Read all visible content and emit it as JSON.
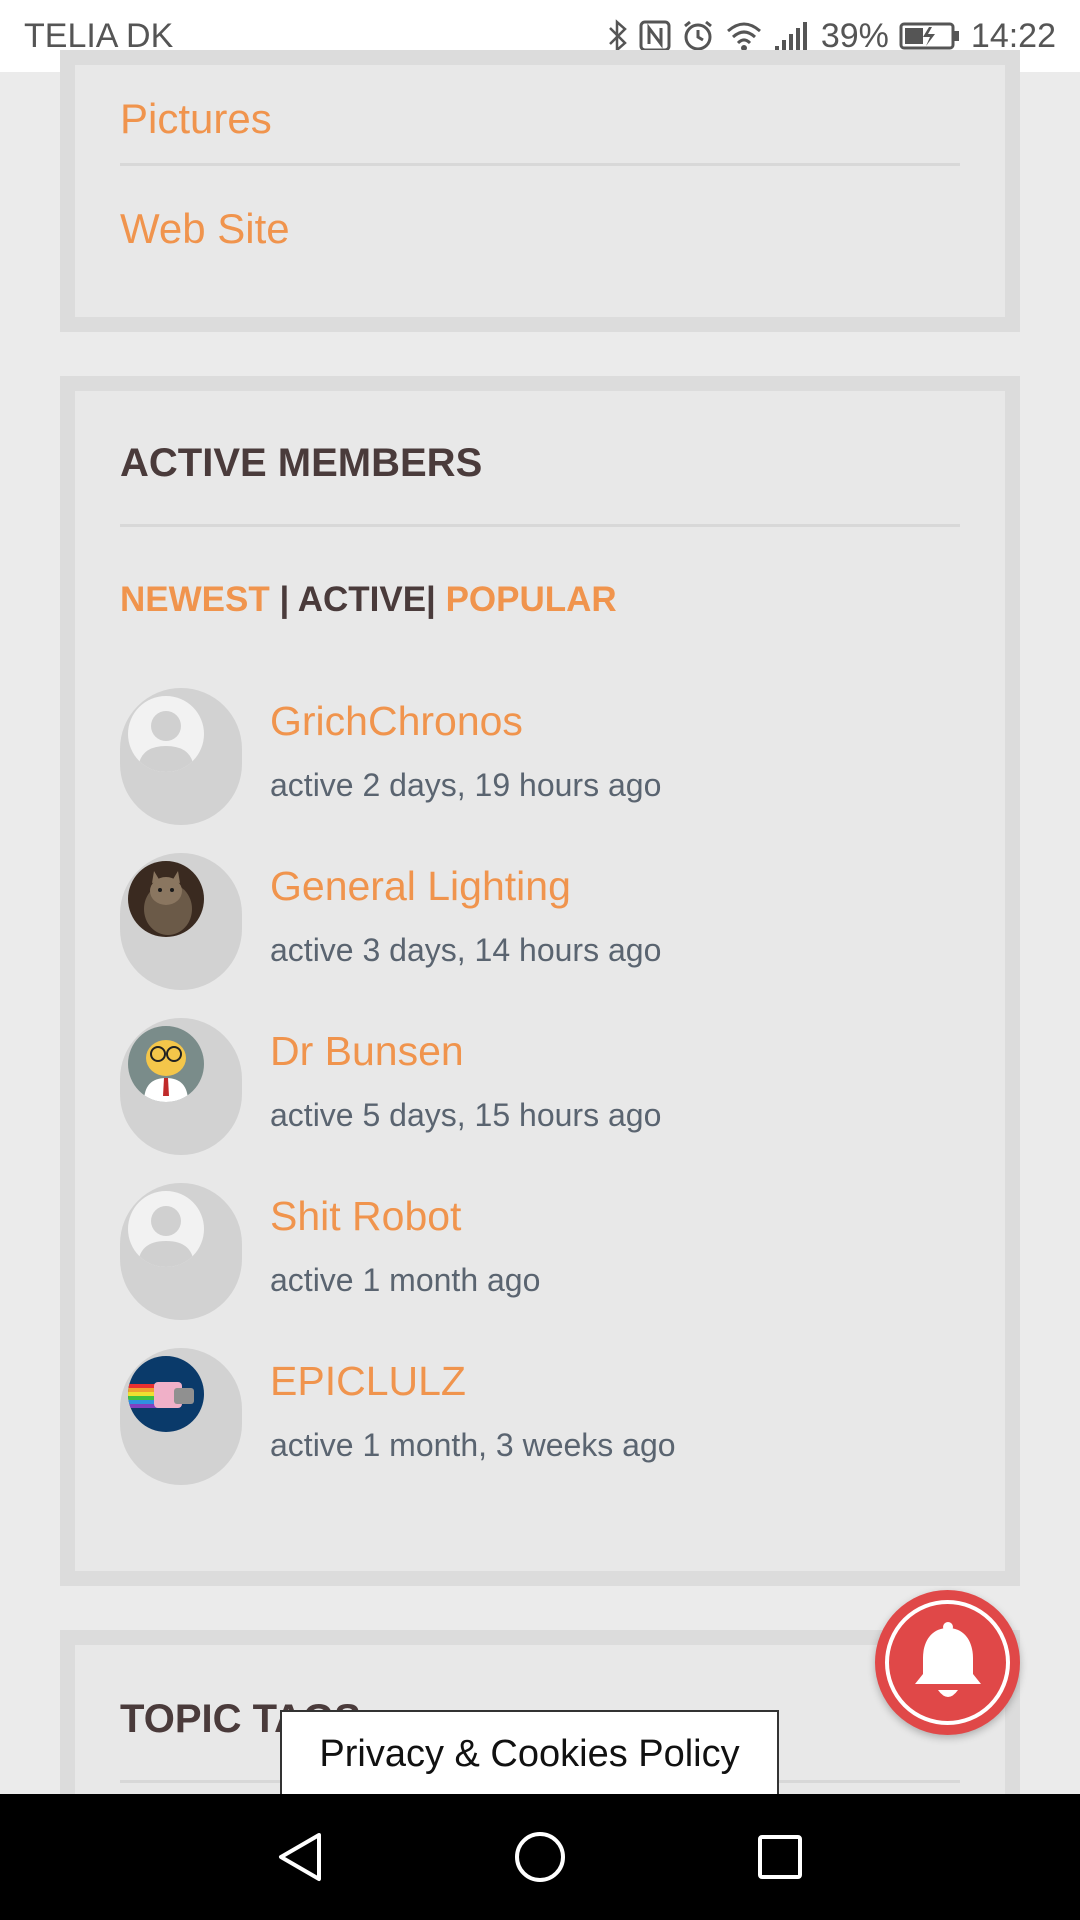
{
  "status_bar": {
    "carrier": "TELIA DK",
    "battery": "39%",
    "time": "14:22"
  },
  "links_card": {
    "items": [
      "Pictures",
      "Web Site"
    ]
  },
  "active_members": {
    "title": "ACTIVE MEMBERS",
    "tabs": {
      "newest": "NEWEST",
      "sep1": " | ",
      "active": "ACTIVE",
      "sep2": "| ",
      "popular": "POPULAR"
    },
    "members": [
      {
        "name": "GrichChronos",
        "active": "active 2 days, 19 hours ago",
        "avatar": "default-avatar-icon"
      },
      {
        "name": "General Lighting",
        "active": "active 3 days, 14 hours ago",
        "avatar": "cat-photo-avatar"
      },
      {
        "name": "Dr Bunsen",
        "active": "active 5 days, 15 hours ago",
        "avatar": "cartoon-scientist-avatar"
      },
      {
        "name": "Shit Robot",
        "active": "active 1 month ago",
        "avatar": "default-avatar-icon"
      },
      {
        "name": "EPICLULZ",
        "active": "active 1 month, 3 weeks ago",
        "avatar": "nyan-cat-avatar"
      }
    ]
  },
  "topic_tags": {
    "title": "TOPIC TAGS"
  },
  "privacy": {
    "label": "Privacy & Cookies Policy"
  },
  "colors": {
    "accent": "#f0944d",
    "heading": "#4a3b3b",
    "bell": "#e04848"
  }
}
